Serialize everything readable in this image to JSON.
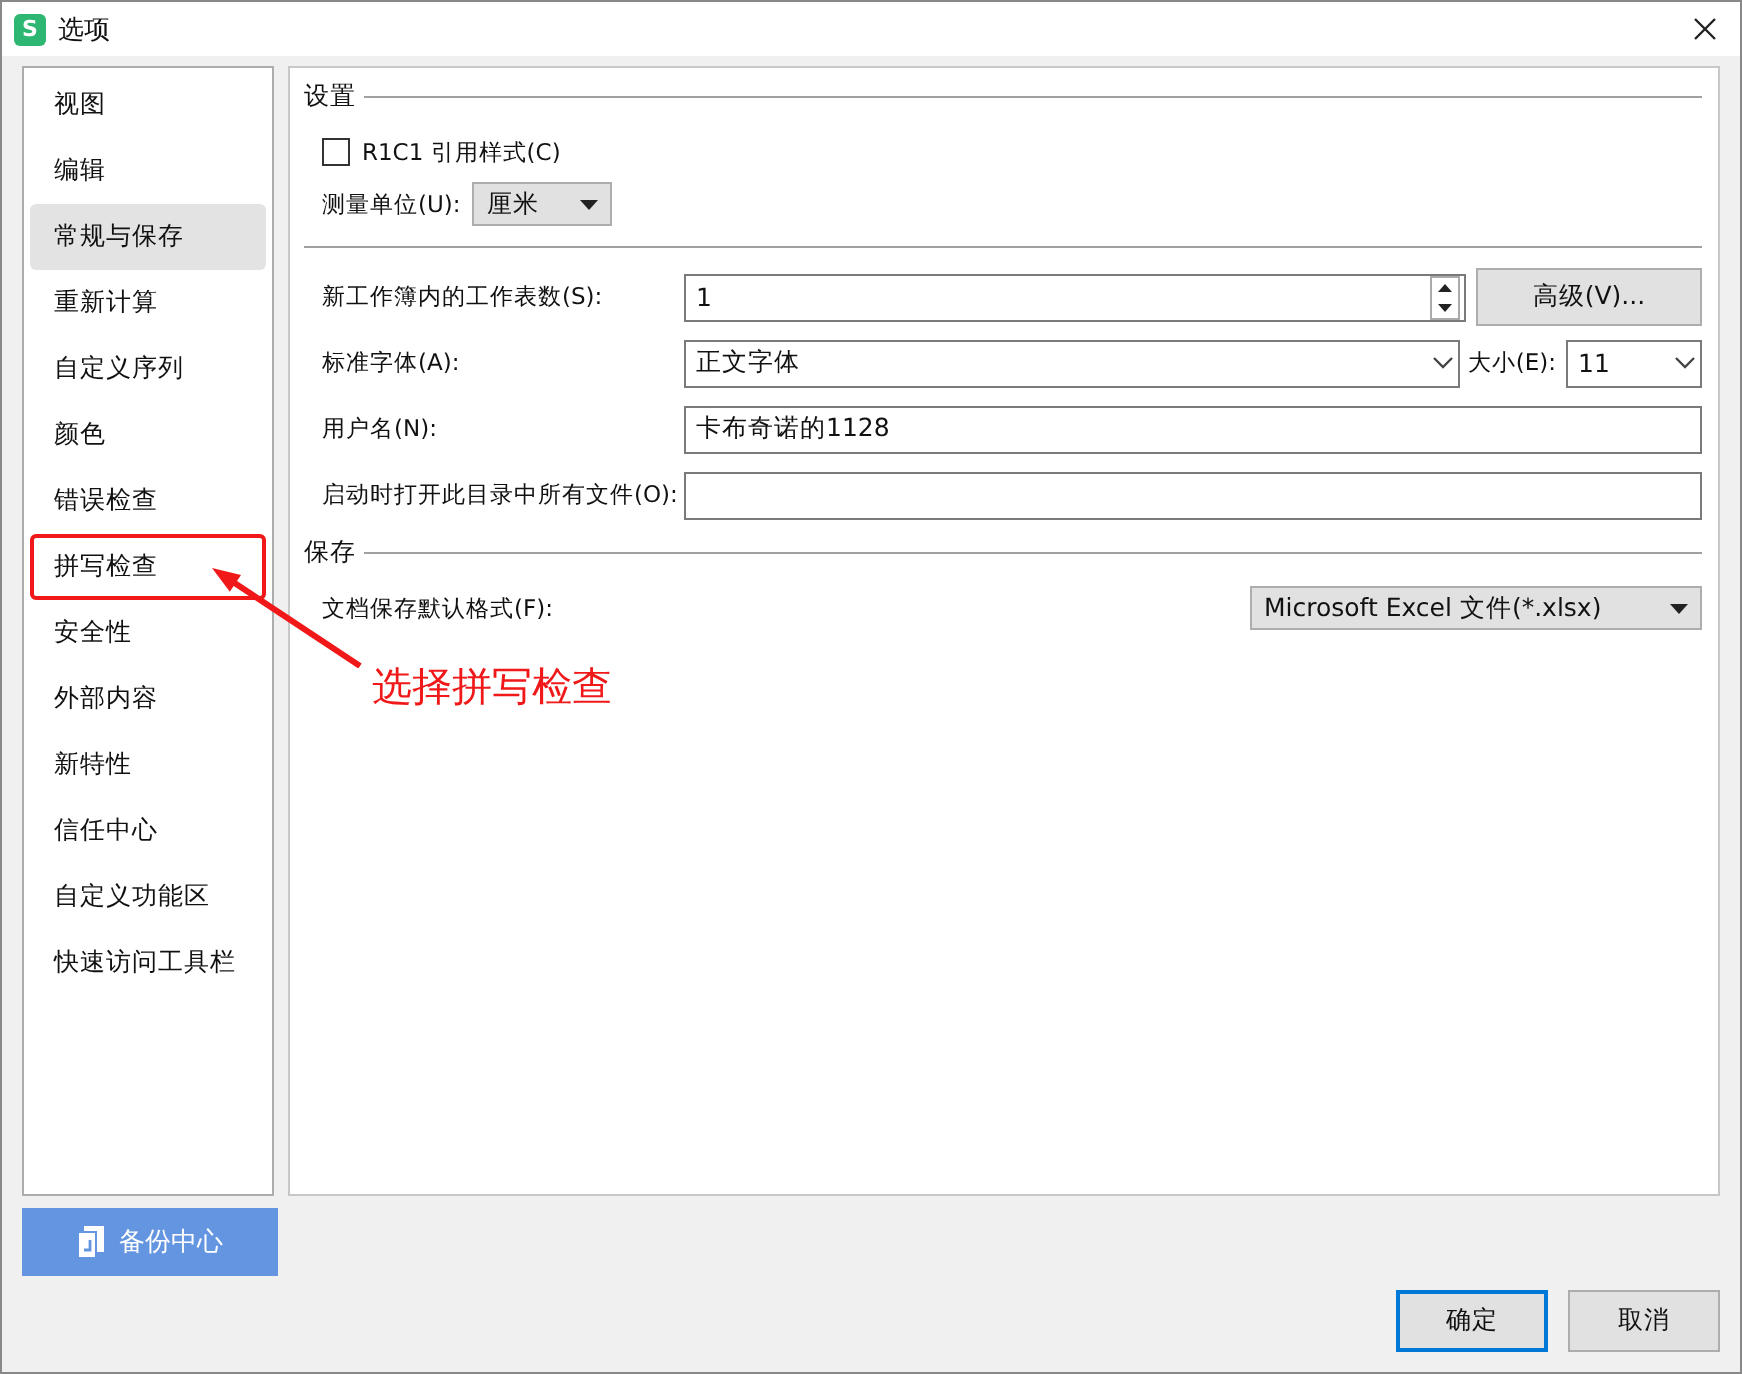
{
  "window": {
    "app_icon": "S",
    "title": "选项"
  },
  "sidebar": {
    "items": [
      {
        "label": "视图",
        "selected": false,
        "highlighted": false
      },
      {
        "label": "编辑",
        "selected": false,
        "highlighted": false
      },
      {
        "label": "常规与保存",
        "selected": true,
        "highlighted": false
      },
      {
        "label": "重新计算",
        "selected": false,
        "highlighted": false
      },
      {
        "label": "自定义序列",
        "selected": false,
        "highlighted": false
      },
      {
        "label": "颜色",
        "selected": false,
        "highlighted": false
      },
      {
        "label": "错误检查",
        "selected": false,
        "highlighted": false
      },
      {
        "label": "拼写检查",
        "selected": false,
        "highlighted": true
      },
      {
        "label": "安全性",
        "selected": false,
        "highlighted": false
      },
      {
        "label": "外部内容",
        "selected": false,
        "highlighted": false
      },
      {
        "label": "新特性",
        "selected": false,
        "highlighted": false
      },
      {
        "label": "信任中心",
        "selected": false,
        "highlighted": false
      },
      {
        "label": "自定义功能区",
        "selected": false,
        "highlighted": false
      },
      {
        "label": "快速访问工具栏",
        "selected": false,
        "highlighted": false
      }
    ]
  },
  "settings": {
    "title": "设置",
    "r1c1": {
      "label": "R1C1 引用样式(C)",
      "checked": false
    },
    "unit": {
      "label": "测量单位(U):",
      "value": "厘米"
    }
  },
  "fields": [
    {
      "kind": "spinner",
      "label": "新工作簿内的工作表数(S):",
      "value": "1",
      "button": "高级(V)..."
    },
    {
      "kind": "font",
      "label": "标准字体(A):",
      "value": "正文字体",
      "size_label": "大小(E):",
      "size_value": "11"
    },
    {
      "kind": "text",
      "label": "用户名(N):",
      "value": "卡布奇诺的1128"
    },
    {
      "kind": "text",
      "label": "启动时打开此目录中所有文件(O):"
    }
  ],
  "save": {
    "title": "保存",
    "format": {
      "label": "文档保存默认格式(F):",
      "value": "Microsoft Excel 文件(*.xlsx)"
    }
  },
  "backup_button": "备份中心",
  "buttons": [
    {
      "label": "确定",
      "default": true
    },
    {
      "label": "取消",
      "default": false
    }
  ],
  "annotation": {
    "text": "选择拼写检查"
  }
}
